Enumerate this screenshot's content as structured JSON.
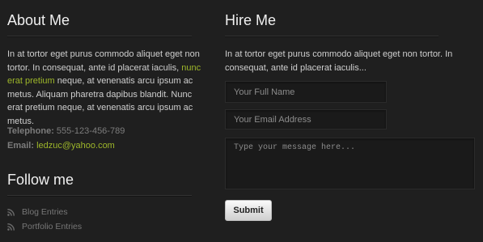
{
  "about": {
    "title": "About Me",
    "text_part1": "In at tortor eget purus commodo aliquet eget non tortor. In consequat, ante id placerat iaculis, ",
    "text_link": "nunc erat pretium",
    "text_part2": " neque, at venenatis arcu ipsum ac metus. Aliquam pharetra dapibus blandit. Nunc erat pretium neque, at venenatis arcu ipsum ac metus.",
    "phone_label": "Telephone:",
    "phone_value": " 555-123-456-789",
    "email_label": "Email:",
    "email_value": "ledzuc@yahoo.com"
  },
  "follow": {
    "title": "Follow me",
    "items": [
      {
        "label": "Blog Entries",
        "icon": "rss-icon"
      },
      {
        "label": "Portfolio Entries",
        "icon": "rss-icon"
      }
    ]
  },
  "hire": {
    "title": "Hire Me",
    "text": "In at tortor eget purus commodo aliquet eget non tortor. In consequat, ante id placerat iaculis...",
    "name_placeholder": "Your Full Name",
    "email_placeholder": "Your Email Address",
    "message_placeholder": "Type your message here...",
    "submit_label": "Submit"
  },
  "colors": {
    "background": "#1f1f1f",
    "accent": "#9db62a",
    "heading": "#f0f0f0"
  }
}
